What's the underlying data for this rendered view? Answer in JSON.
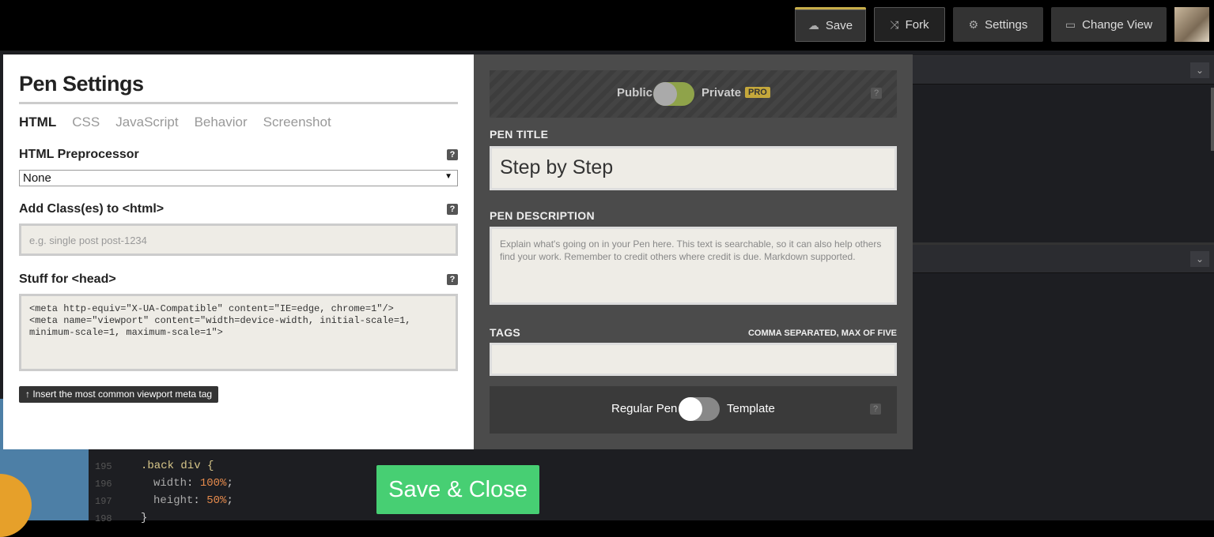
{
  "topbar": {
    "save_label": "Save",
    "fork_label": "Fork",
    "settings_label": "Settings",
    "change_view_label": "Change View"
  },
  "editor": {
    "lines": [
      {
        "num": "195",
        "text": ".back div {"
      },
      {
        "num": "196",
        "prop": "width",
        "value": "100%"
      },
      {
        "num": "197",
        "prop": "height",
        "value": "50%"
      },
      {
        "num": "198",
        "text": "}"
      }
    ]
  },
  "modal": {
    "title": "Pen Settings",
    "tabs": [
      "HTML",
      "CSS",
      "JavaScript",
      "Behavior",
      "Screenshot"
    ],
    "active_tab": "HTML",
    "preprocessor_label": "HTML Preprocessor",
    "preprocessor_value": "None",
    "classes_label": "Add Class(es) to <html>",
    "classes_placeholder": "e.g. single post post-1234",
    "head_label": "Stuff for <head>",
    "head_value": "<meta http-equiv=\"X-UA-Compatible\" content=\"IE=edge, chrome=1\"/>\n<meta name=\"viewport\" content=\"width=device-width, initial-scale=1,\nminimum-scale=1, maximum-scale=1\">",
    "meta_button": "↑ Insert the most common viewport meta tag",
    "help_icon": "?",
    "privacy": {
      "public": "Public",
      "private": "Private",
      "pro": "PRO"
    },
    "pen_title_label": "PEN TITLE",
    "pen_title_value": "Step by Step",
    "pen_desc_label": "PEN DESCRIPTION",
    "pen_desc_placeholder": "Explain what's going on in your Pen here. This text is searchable, so it can also help others find your work. Remember to credit others where credit is due. Markdown supported.",
    "tags_label": "TAGS",
    "tags_note": "COMMA SEPARATED, MAX OF FIVE",
    "template": {
      "regular": "Regular Pen",
      "template": "Template"
    },
    "save_close": "Save & Close"
  },
  "colors": {
    "accent_green": "#47cf73",
    "pro_gold": "#c5a83b",
    "toggle_green": "#8fa34a"
  }
}
